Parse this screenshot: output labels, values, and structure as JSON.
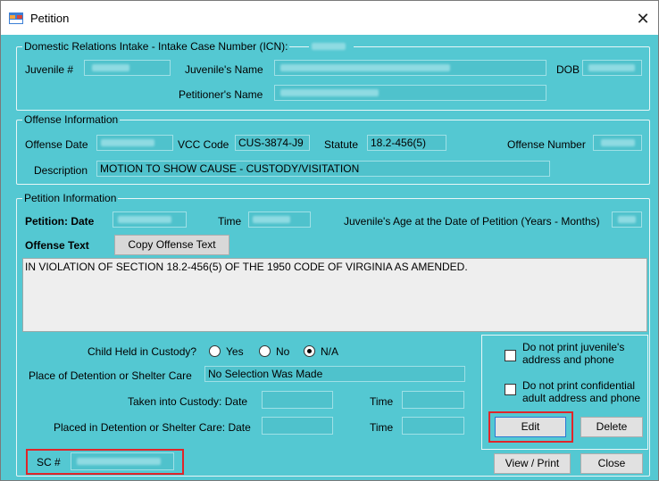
{
  "window": {
    "title": "Petition",
    "close_glyph": "✕"
  },
  "intake": {
    "group_title": "Domestic Relations Intake - Intake Case Number (ICN):",
    "juvenile_num_label": "Juvenile #",
    "juvenile_name_label": "Juvenile's Name",
    "dob_label": "DOB",
    "petitioner_name_label": "Petitioner's Name"
  },
  "offense": {
    "group_title": "Offense Information",
    "date_label": "Offense Date",
    "vcc_label": "VCC Code",
    "vcc_value": "CUS-3874-J9",
    "statute_label": "Statute",
    "statute_value": "18.2-456(5)",
    "number_label": "Offense Number",
    "description_label": "Description",
    "description_value": "MOTION TO SHOW CAUSE - CUSTODY/VISITATION"
  },
  "petition": {
    "group_title": "Petition Information",
    "date_label": "Petition: Date",
    "time_label": "Time",
    "age_label": "Juvenile's Age at the Date of Petition (Years - Months)",
    "offense_text_label": "Offense Text",
    "copy_button": "Copy Offense Text",
    "offense_text": "IN VIOLATION OF SECTION 18.2-456(5) OF THE 1950 CODE OF VIRGINIA AS AMENDED.",
    "custody_label": "Child Held in Custody?",
    "radio_yes": "Yes",
    "radio_no": "No",
    "radio_na": "N/A",
    "detention_place_label": "Place of Detention or Shelter Care",
    "detention_place_value": "No Selection Was Made",
    "taken_custody_label": "Taken into Custody: Date",
    "taken_time_label": "Time",
    "placed_label": "Placed in Detention or Shelter Care: Date",
    "placed_time_label": "Time"
  },
  "options": {
    "no_print_juvenile": "Do not print juvenile's address and phone",
    "no_print_confidential": "Do not print confidential adult address and phone"
  },
  "buttons": {
    "edit": "Edit",
    "delete": "Delete",
    "view_print": "View / Print",
    "close": "Close"
  },
  "sc": {
    "label": "SC #"
  },
  "colors": {
    "background": "#54c8d2",
    "highlight": "#e0252a"
  }
}
